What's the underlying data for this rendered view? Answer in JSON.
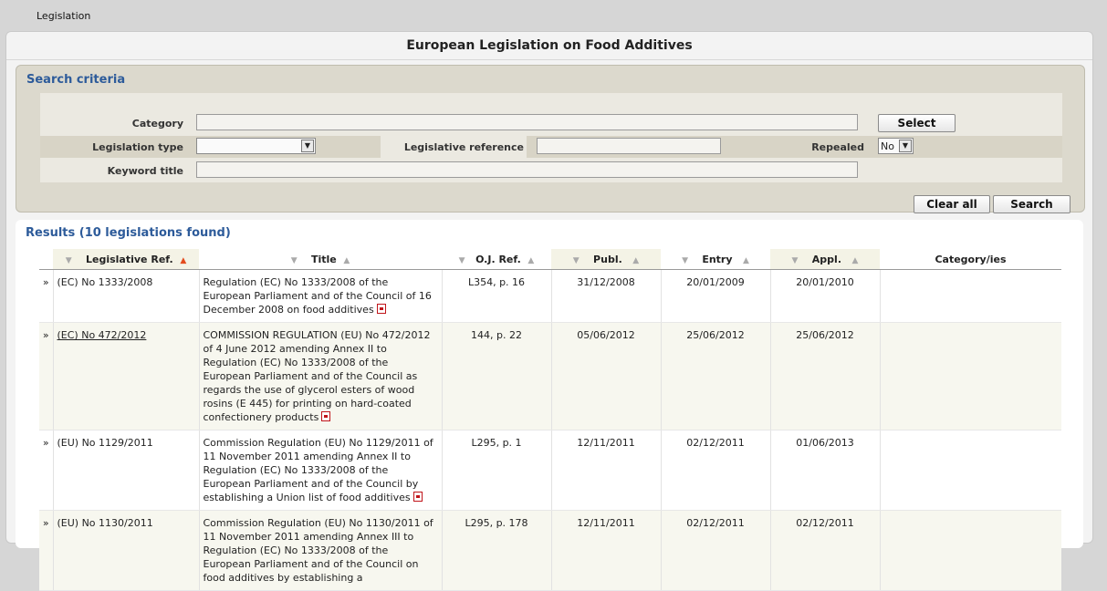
{
  "breadcrumb": "Legislation",
  "title": "European Legislation on Food Additives",
  "search": {
    "section_title": "Search criteria",
    "category_label": "Category",
    "category_value": "",
    "select_button": "Select",
    "legislation_type_label": "Legislation type",
    "legislation_type_value": "",
    "legislative_reference_label": "Legislative reference",
    "legislative_reference_value": "",
    "repealed_label": "Repealed",
    "repealed_value": "No",
    "keyword_title_label": "Keyword title",
    "keyword_title_value": "",
    "clear_all_button": "Clear all",
    "search_button": "Search"
  },
  "results": {
    "title": "Results (10 legislations found)",
    "columns": [
      "Legislative Ref.",
      "Title",
      "O.J. Ref.",
      "Publ.",
      "Entry",
      "Appl.",
      "Category/ies"
    ],
    "rows": [
      {
        "expander": "»",
        "ref": "(EC) No 1333/2008",
        "title": "Regulation (EC) No 1333/2008 of the European Parliament and of the Council of 16 December 2008 on food additives",
        "oj": "L354, p. 16",
        "publ": "31/12/2008",
        "entry": "20/01/2009",
        "appl": "20/01/2010",
        "category": ""
      },
      {
        "expander": "»",
        "ref": "(EC) No 472/2012",
        "title": "COMMISSION REGULATION (EU) No 472/2012 of 4 June 2012 amending Annex II to Regulation (EC) No 1333/2008 of the European Parliament and of the Council as regards the use of glycerol esters of wood rosins (E 445) for printing on hard-coated confectionery products",
        "oj": "144, p. 22",
        "publ": "05/06/2012",
        "entry": "25/06/2012",
        "appl": "25/06/2012",
        "category": ""
      },
      {
        "expander": "»",
        "ref": "(EU) No 1129/2011",
        "title": "Commission Regulation (EU) No 1129/2011 of 11 November 2011 amending Annex II to Regulation (EC) No 1333/2008 of the European Parliament and of the Council by establishing a Union list of food additives",
        "oj": "L295, p. 1",
        "publ": "12/11/2011",
        "entry": "02/12/2011",
        "appl": "01/06/2013",
        "category": ""
      },
      {
        "expander": "»",
        "ref": "(EU) No 1130/2011",
        "title": "Commission Regulation (EU) No 1130/2011 of 11 November 2011 amending Annex III to Regulation (EC) No 1333/2008 of the European Parliament and of the Council on food additives by establishing a",
        "oj": "L295, p. 178",
        "publ": "12/11/2011",
        "entry": "02/12/2011",
        "appl": "02/12/2011",
        "category": ""
      }
    ]
  }
}
